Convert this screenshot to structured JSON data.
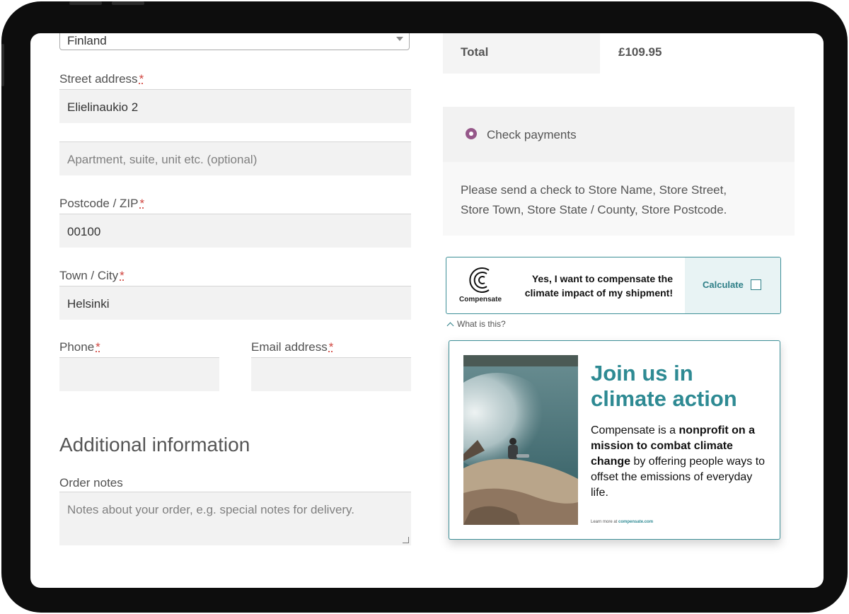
{
  "billing": {
    "country_value": "Finland",
    "street_label": "Street address",
    "street_value": "Elielinaukio 2",
    "apartment_placeholder": "Apartment, suite, unit etc. (optional)",
    "postcode_label": "Postcode / ZIP",
    "postcode_value": "00100",
    "city_label": "Town / City",
    "city_value": "Helsinki",
    "phone_label": "Phone",
    "email_label": "Email address",
    "required_marker": "*"
  },
  "additional": {
    "heading": "Additional information",
    "notes_label": "Order notes",
    "notes_placeholder": "Notes about your order, e.g. special notes for delivery."
  },
  "order": {
    "total_label": "Total",
    "total_value": "£109.95"
  },
  "payment": {
    "method_label": "Check payments",
    "description": "Please send a check to Store Name, Store Street, Store Town, Store State / County, Store Postcode."
  },
  "compensate": {
    "brand": "Compensate",
    "message": "Yes, I want to compensate the climate impact of my shipment!",
    "calculate_label": "Calculate",
    "what_is_this": "What is this?",
    "card_title": "Join us in climate action",
    "card_body_1": "Compensate is a ",
    "card_body_bold": "nonprofit on a mission to combat climate change",
    "card_body_2": " by offering people ways to offset the emissions of everyday life.",
    "footer_prefix": "Learn more at ",
    "footer_link": "compensate.com"
  },
  "colors": {
    "accent_teal": "#2e8a93",
    "radio_purple": "#96588a",
    "required_red": "#d0443e"
  }
}
